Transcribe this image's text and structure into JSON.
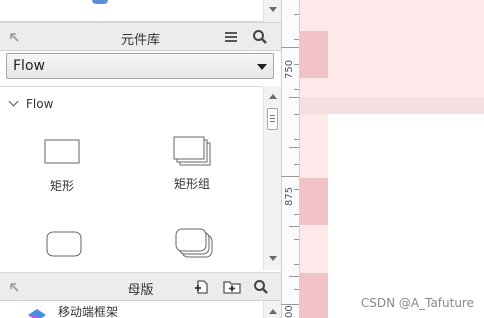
{
  "widget_library": {
    "title": "元件库",
    "selected_library": "Flow",
    "category": "Flow",
    "widgets": [
      {
        "label": "矩形",
        "icon": "rectangle-icon"
      },
      {
        "label": "矩形组",
        "icon": "rectangle-group-icon"
      },
      {
        "label": "",
        "icon": "rounded-rectangle-icon"
      },
      {
        "label": "",
        "icon": "rounded-rectangle-group-icon"
      }
    ],
    "icons": {
      "collapse": "collapse-arrow-icon",
      "menu": "menu-icon",
      "search": "search-icon"
    }
  },
  "masters": {
    "title": "母版",
    "first_item": "移动端框架",
    "icons": [
      "add-master-icon",
      "add-folder-icon",
      "search-icon"
    ]
  },
  "ruler": {
    "labels": [
      "750",
      "875",
      "00"
    ]
  },
  "watermark": "CSDN @A_Tafuture",
  "colors": {
    "canvas_bg": "#fde9ea",
    "guide_band": "#f1c3c7",
    "panel_header": "#ececec"
  }
}
